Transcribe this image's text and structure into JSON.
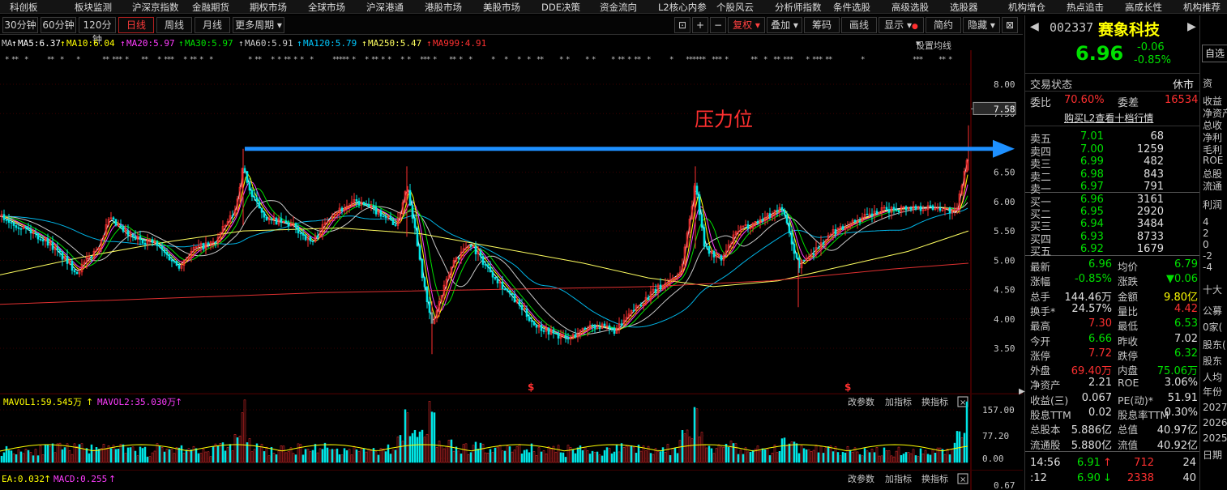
{
  "menu": {
    "items": [
      "科创板",
      "板块监测",
      "沪深京指数",
      "金融期货",
      "期权市场",
      "全球市场",
      "沪深港通",
      "港股市场",
      "美股市场",
      "DDE决策",
      "资金流向",
      "L2核心内参",
      "个股风云",
      "分析师指数",
      "条件选股",
      "高级选股",
      "选股器",
      "机构增仓",
      "热点追击",
      "高成长性",
      "机构推荐"
    ]
  },
  "periods": {
    "items": [
      "30分钟",
      "60分钟",
      "120分钟",
      "日线",
      "周线",
      "月线",
      "更多周期"
    ],
    "active": "日线"
  },
  "toolbar": {
    "plus": "+",
    "minus": "−",
    "fuquan": "复权",
    "diejia": "叠加",
    "chouma": "筹码",
    "huaxian": "画线",
    "xianshi": "显示",
    "jianyue": "简约",
    "yincang": "隐藏"
  },
  "ma": {
    "prefix": "MA",
    "items": [
      {
        "label": "MA5:6.37",
        "color": "#ffffff"
      },
      {
        "label": "MA10:6.04",
        "color": "#ffff00"
      },
      {
        "label": "MA20:5.97",
        "color": "#ff3cff"
      },
      {
        "label": "MA30:5.97",
        "color": "#00e000"
      },
      {
        "label": "MA60:5.91",
        "color": "#c8c8c8"
      },
      {
        "label": "MA120:5.79",
        "color": "#00c8ff"
      },
      {
        "label": "MA250:5.47",
        "color": "#ffff60"
      },
      {
        "label": "MA999:4.91",
        "color": "#ff3030"
      }
    ],
    "settings": "设置均线"
  },
  "price_axis": {
    "ticks": [
      "8.00",
      "7.50",
      "6.50",
      "6.00",
      "5.50",
      "5.00",
      "4.50",
      "4.00",
      "3.50"
    ],
    "current": "7.58"
  },
  "annotation": {
    "text": "压力位"
  },
  "dollar_marks": [
    "$",
    "$"
  ],
  "vol": {
    "mavol1": "MAVOL1:59.545万",
    "mavol2": "MAVOL2:35.030万",
    "ticks": [
      "157.00",
      "77.20",
      "0.00"
    ],
    "buttons": [
      "改参数",
      "加指标",
      "换指标"
    ]
  },
  "macd": {
    "dea": "EA:0.032",
    "macd": "MACD:0.255",
    "tick": "0.67",
    "buttons": [
      "改参数",
      "加指标",
      "换指标"
    ]
  },
  "stock": {
    "code": "002337",
    "name": "赛象科技",
    "price": "6.96",
    "change": "-0.06",
    "pct": "-0.85%",
    "add_btn": "自选"
  },
  "status": {
    "label": "交易状态",
    "value": "休市"
  },
  "weibi": {
    "label": "委比",
    "value": "70.60%",
    "label2": "委差",
    "value2": "16534"
  },
  "l2_link": "购买L2查看十档行情",
  "asks": [
    {
      "label": "卖五",
      "price": "7.01",
      "vol": "68"
    },
    {
      "label": "卖四",
      "price": "7.00",
      "vol": "1259"
    },
    {
      "label": "卖三",
      "price": "6.99",
      "vol": "482"
    },
    {
      "label": "卖二",
      "price": "6.98",
      "vol": "843"
    },
    {
      "label": "卖一",
      "price": "6.97",
      "vol": "791"
    }
  ],
  "bids": [
    {
      "label": "买一",
      "price": "6.96",
      "vol": "3161"
    },
    {
      "label": "买二",
      "price": "6.95",
      "vol": "2920"
    },
    {
      "label": "买三",
      "price": "6.94",
      "vol": "3484"
    },
    {
      "label": "买四",
      "price": "6.93",
      "vol": "8733"
    },
    {
      "label": "买五",
      "price": "6.92",
      "vol": "1679"
    }
  ],
  "stats": [
    {
      "l1": "最新",
      "v1": "6.96",
      "c1": "#00e000",
      "l2": "均价",
      "v2": "6.79",
      "c2": "#00e000"
    },
    {
      "l1": "涨幅",
      "v1": "-0.85%",
      "c1": "#00e000",
      "l2": "涨跌",
      "v2": "▼0.06",
      "c2": "#00e000"
    },
    {
      "l1": "总手",
      "v1": "144.46万",
      "c1": "#e0e0e0",
      "l2": "金额",
      "v2": "9.80亿",
      "c2": "#ffff00"
    },
    {
      "l1": "换手*",
      "v1": "24.57%",
      "c1": "#e0e0e0",
      "l2": "量比",
      "v2": "4.42",
      "c2": "#ff3030"
    },
    {
      "l1": "最高",
      "v1": "7.30",
      "c1": "#ff3030",
      "l2": "最低",
      "v2": "6.53",
      "c2": "#00e000"
    },
    {
      "l1": "今开",
      "v1": "6.66",
      "c1": "#00e000",
      "l2": "昨收",
      "v2": "7.02",
      "c2": "#e0e0e0"
    },
    {
      "l1": "涨停",
      "v1": "7.72",
      "c1": "#ff3030",
      "l2": "跌停",
      "v2": "6.32",
      "c2": "#00e000"
    },
    {
      "l1": "外盘",
      "v1": "69.40万",
      "c1": "#ff3030",
      "l2": "内盘",
      "v2": "75.06万",
      "c2": "#00e000"
    },
    {
      "l1": "净资产",
      "v1": "2.21",
      "c1": "#e0e0e0",
      "l2": "ROE",
      "v2": "3.06%",
      "c2": "#e0e0e0"
    },
    {
      "l1": "收益(三)",
      "v1": "0.067",
      "c1": "#e0e0e0",
      "l2": "PE(动)*",
      "v2": "51.91",
      "c2": "#e0e0e0"
    },
    {
      "l1": "股息TTM",
      "v1": "0.02",
      "c1": "#e0e0e0",
      "l2": "股息率TTM",
      "v2": "0.30%",
      "c2": "#e0e0e0"
    },
    {
      "l1": "总股本",
      "v1": "5.886亿",
      "c1": "#e0e0e0",
      "l2": "总值",
      "v2": "40.97亿",
      "c2": "#e0e0e0"
    },
    {
      "l1": "流通股",
      "v1": "5.880亿",
      "c1": "#e0e0e0",
      "l2": "流值",
      "v2": "40.92亿",
      "c2": "#e0e0e0"
    }
  ],
  "ticks_list": [
    {
      "time": "14:56",
      "price": "6.91",
      "arrow": "↑",
      "vol": "712",
      "n": "24",
      "acolor": "#ff3030"
    },
    {
      "time": ":12",
      "price": "6.90",
      "arrow": "↓",
      "vol": "2338",
      "n": "40",
      "acolor": "#00e000"
    }
  ],
  "far_right": {
    "items": [
      "资",
      "收益",
      "净资产",
      "总收",
      "净利",
      "毛利",
      "ROE",
      "总股",
      "流通",
      "利润",
      "4",
      "2",
      "0",
      "-2",
      "-4",
      "十大",
      "公募",
      "0家(",
      "股东(",
      "股东",
      "人均",
      "年份",
      "2027",
      "2026",
      "2025",
      "日期"
    ]
  },
  "colors": {
    "up": "#ff3030",
    "down": "#00ffff",
    "accent_red": "#ff3030",
    "blue_arrow": "#1e90ff"
  }
}
